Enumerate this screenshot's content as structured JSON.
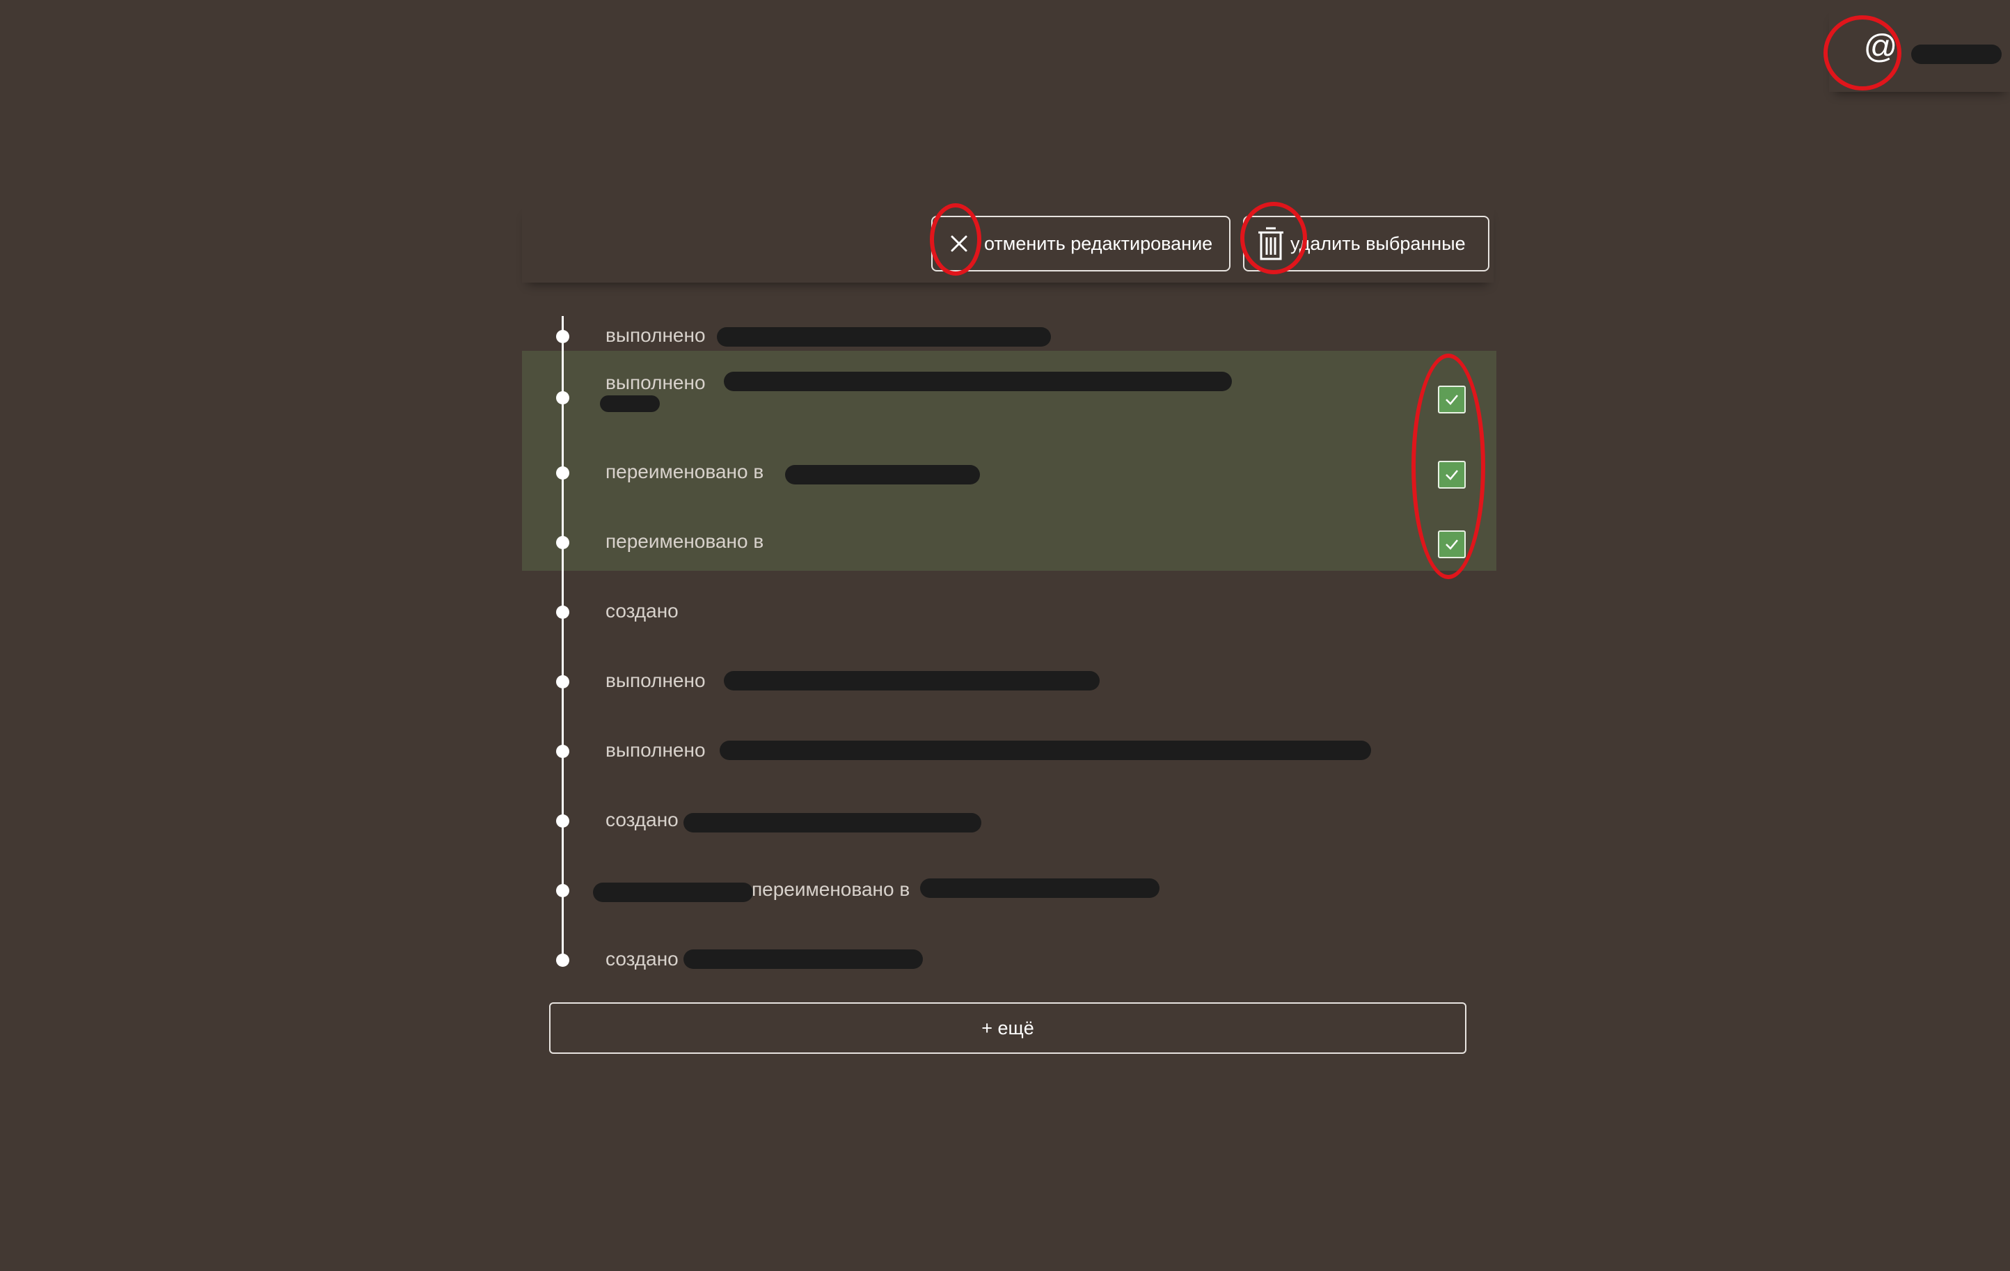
{
  "user": {
    "icon": "at-icon",
    "at_symbol": "@",
    "name_redacted": true
  },
  "toolbar": {
    "cancel_icon": "close-icon",
    "cancel_label": "отменить редактирование",
    "delete_icon": "trash-icon",
    "delete_label": "удалить выбранные"
  },
  "history": {
    "entries": [
      {
        "text": "выполнено",
        "selected": false,
        "has_checkbox": false
      },
      {
        "text": "выполнено",
        "selected": true,
        "has_checkbox": true,
        "checked": true
      },
      {
        "text": "переименовано в",
        "selected": true,
        "has_checkbox": true,
        "checked": true
      },
      {
        "text": "переименовано в",
        "selected": true,
        "has_checkbox": true,
        "checked": true
      },
      {
        "text": "создано",
        "selected": false,
        "has_checkbox": false
      },
      {
        "text": "выполнено",
        "selected": false,
        "has_checkbox": false
      },
      {
        "text": "выполнено",
        "selected": false,
        "has_checkbox": false
      },
      {
        "text": "создано",
        "selected": false,
        "has_checkbox": false
      },
      {
        "text": "переименовано в",
        "selected": false,
        "has_checkbox": false
      },
      {
        "text": "создано",
        "selected": false,
        "has_checkbox": false
      }
    ]
  },
  "more_button_label": "+ ещё",
  "colors": {
    "background": "#433933",
    "selected_row": "#4e503d",
    "checkbox": "#5f9e56",
    "annotation": "#e0151b"
  }
}
